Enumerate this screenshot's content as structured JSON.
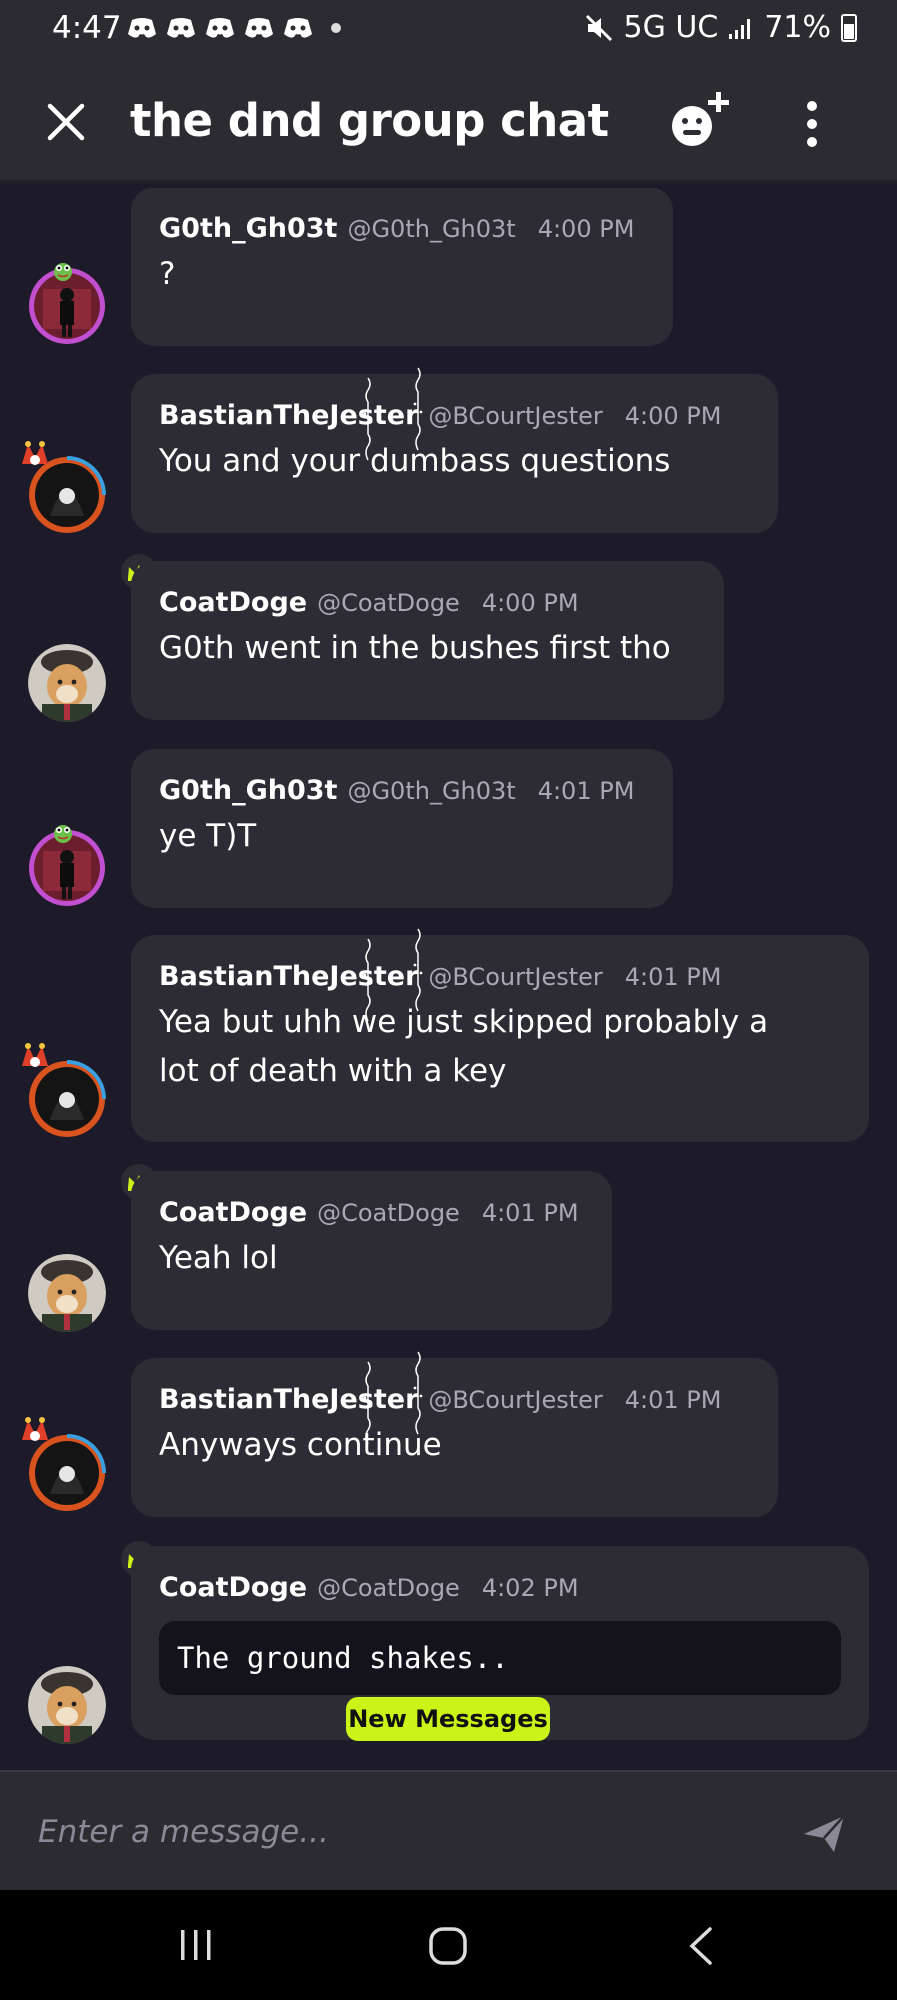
{
  "status_bar": {
    "time": "4:47",
    "network": "5G UC",
    "battery": "71%",
    "notification_icons": [
      "discord-icon",
      "discord-icon",
      "discord-icon",
      "discord-icon",
      "discord-icon"
    ]
  },
  "header": {
    "title": "the dnd group chat"
  },
  "messages": [
    {
      "author": "G0th_Gh03t",
      "handle": "@G0th_Gh03t",
      "time": "4:00 PM",
      "text": "?"
    },
    {
      "author": "BastianTheJester",
      "handle": "@BCourtJester",
      "time": "4:00 PM",
      "text": "You and your dumbass questions"
    },
    {
      "author": "CoatDoge",
      "handle": "@CoatDoge",
      "time": "4:00 PM",
      "text": "G0th went in the bushes first tho"
    },
    {
      "author": "G0th_Gh03t",
      "handle": "@G0th_Gh03t",
      "time": "4:01 PM",
      "text": "ye T)T"
    },
    {
      "author": "BastianTheJester",
      "handle": "@BCourtJester",
      "time": "4:01 PM",
      "text_line1": "Yea but uhh we just skipped probably a",
      "text_line2": "lot of death with a key"
    },
    {
      "author": "CoatDoge",
      "handle": "@CoatDoge",
      "time": "4:01 PM",
      "text": "Yeah lol"
    },
    {
      "author": "BastianTheJester",
      "handle": "@BCourtJester",
      "time": "4:01 PM",
      "text": "Anyways continue"
    },
    {
      "author": "CoatDoge",
      "handle": "@CoatDoge",
      "time": "4:02 PM",
      "code": "The ground shakes.."
    }
  ],
  "new_messages_label": "New Messages",
  "composer": {
    "placeholder": "Enter a message..."
  },
  "colors": {
    "background": "#1d1b29",
    "bubble": "#2d2c35",
    "header": "#2b2b31",
    "accent": "#ccf317"
  }
}
